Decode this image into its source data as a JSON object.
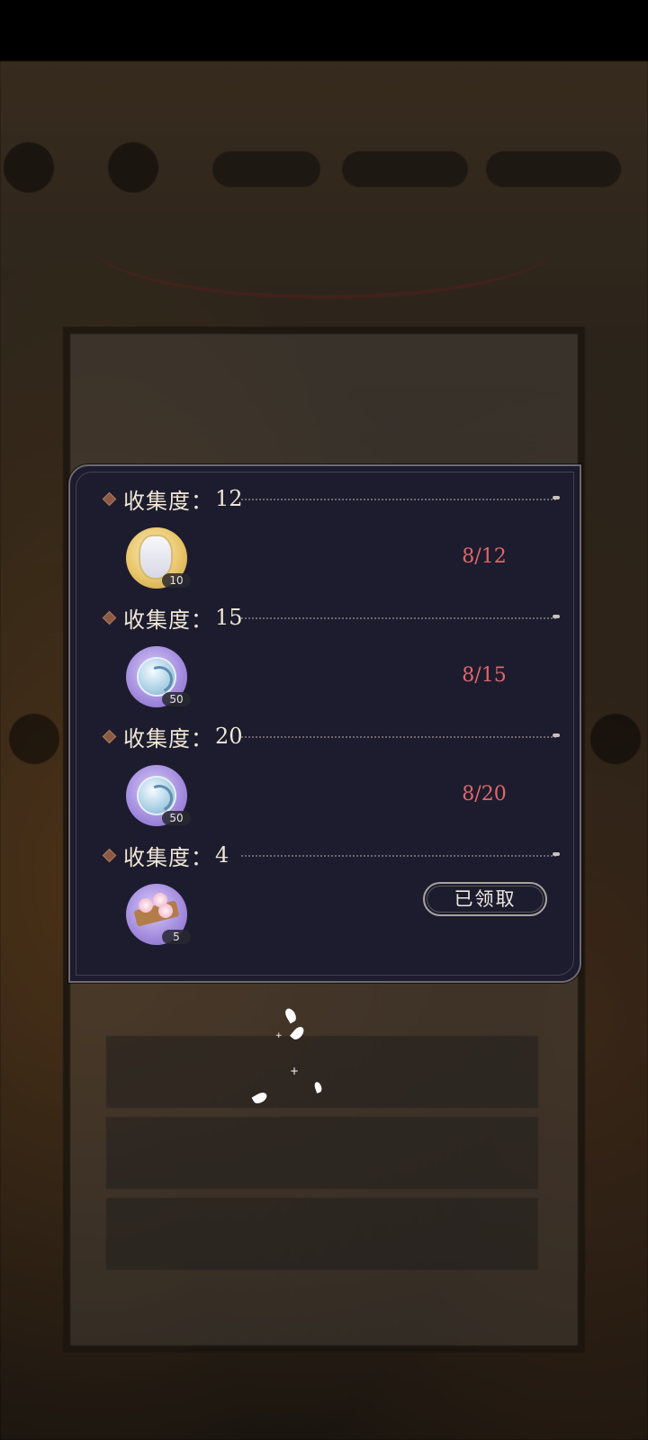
{
  "collection_panel": {
    "sections": [
      {
        "label": "收集度：",
        "value": "12",
        "item_icon": "portrait-token-icon",
        "item_qty": "10",
        "progress": "8/12"
      },
      {
        "label": "收集度：",
        "value": "15",
        "item_icon": "jade-coin-icon",
        "item_qty": "50",
        "progress": "8/15"
      },
      {
        "label": "收集度：",
        "value": "20",
        "item_icon": "jade-coin-icon",
        "item_qty": "50",
        "progress": "8/20"
      },
      {
        "label": "收集度：",
        "value": "4",
        "item_icon": "sakura-cake-icon",
        "item_qty": "5",
        "claimed_label": "已领取"
      }
    ]
  },
  "colors": {
    "panel_bg": "#1c1c2e",
    "progress_red": "#e0676a",
    "header_text": "#f0e6d4"
  }
}
